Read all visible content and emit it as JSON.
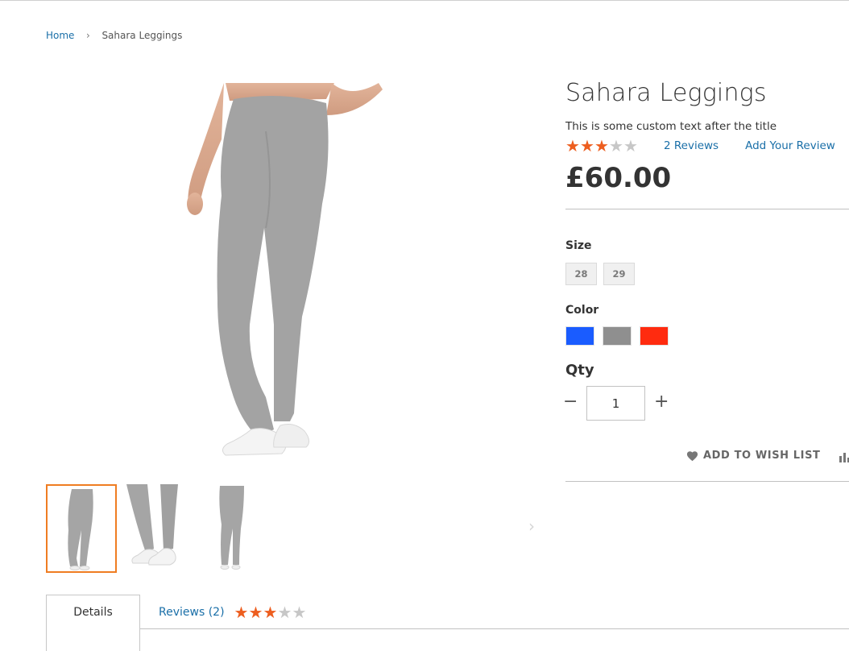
{
  "breadcrumb": {
    "home": "Home",
    "separator": "›",
    "current": "Sahara Leggings"
  },
  "product": {
    "title": "Sahara Leggings",
    "custom_text": "This is some custom text after the title",
    "rating": {
      "stars_filled": 3,
      "stars_total": 5
    },
    "reviews_link": "2  Reviews",
    "add_review_link": "Add Your Review",
    "price": "£60.00"
  },
  "options": {
    "size_label": "Size",
    "sizes": [
      "28",
      "29"
    ],
    "color_label": "Color",
    "colors": [
      "#1a5cff",
      "#8f8f8f",
      "#ff2b0f"
    ]
  },
  "quantity": {
    "label": "Qty",
    "value": "1",
    "minus": "−",
    "plus": "+"
  },
  "actions": {
    "wishlist": "ADD TO WISH LIST",
    "wishlist_icon": "heart-icon",
    "compare_icon": "compare-icon"
  },
  "gallery": {
    "thumbnails": 3,
    "active_thumbnail": 1,
    "next_arrow": "›"
  },
  "tabs": {
    "details": "Details",
    "reviews": "Reviews (2)"
  },
  "colors": {
    "link": "#1a6fa8",
    "star": "#ed5e1f",
    "active_thumb_border": "#ef7d22"
  }
}
